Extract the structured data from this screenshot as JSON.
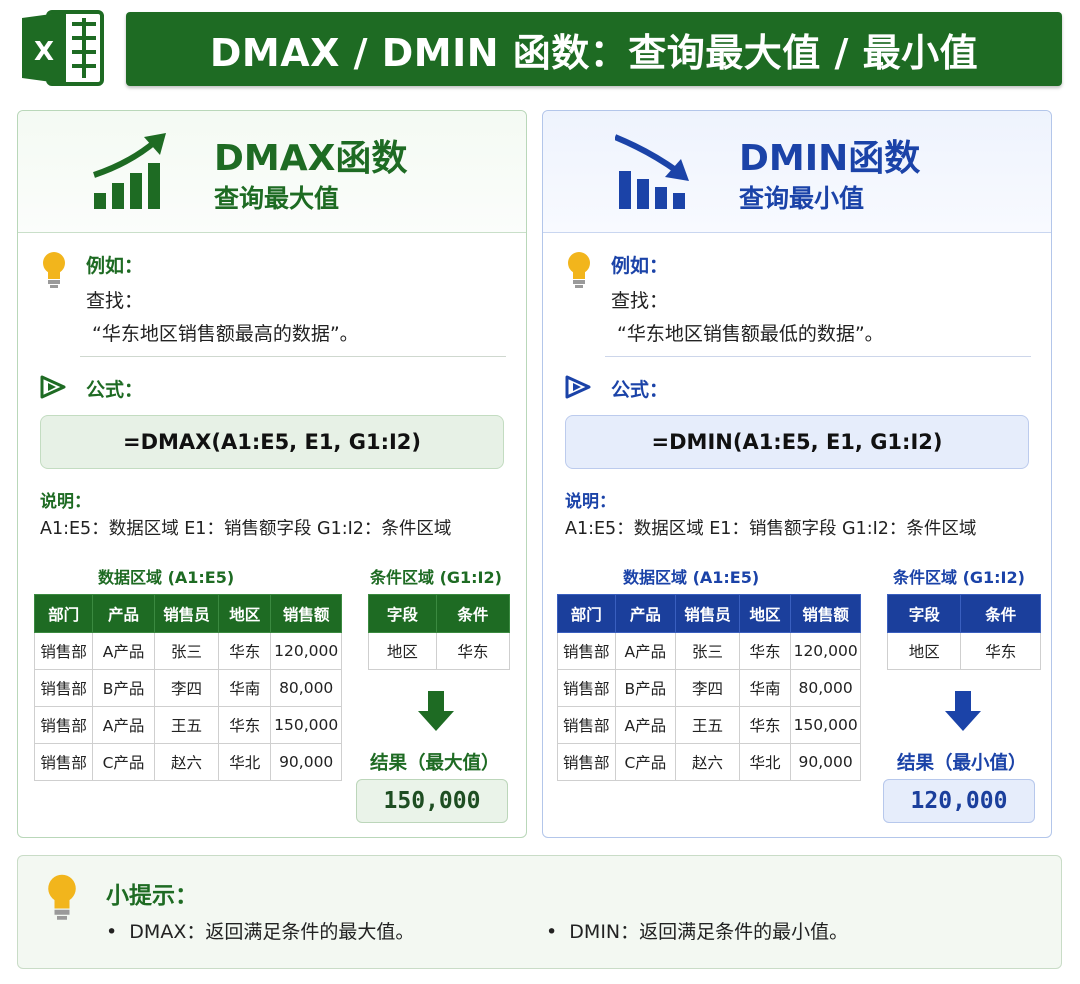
{
  "title": "DMAX / DMIN 函数：查询最大值 / 最小值",
  "logo_letter": "X",
  "colors": {
    "green": "#1e6b23",
    "blue": "#1b3f9c",
    "bulb": "#f2b51c"
  },
  "dmax": {
    "title": "DMAX函数",
    "subtitle": "查询最大值",
    "example_label": "例如：",
    "example_line1": "查找：",
    "example_line2": "“华东地区销售额最高的数据”。",
    "formula_label": "公式：",
    "formula": "=DMAX(A1:E5, E1, G1:I2)",
    "explain_label": "说明：",
    "explain_text": "A1:E5：数据区域    E1：销售额字段    G1:I2：条件区域",
    "data_caption": "数据区域 (A1:E5)",
    "criteria_caption": "条件区域 (G1:I2)",
    "result_label": "结果（最大值）",
    "result_value": "150,000"
  },
  "dmin": {
    "title": "DMIN函数",
    "subtitle": "查询最小值",
    "example_label": "例如：",
    "example_line1": "查找：",
    "example_line2": "“华东地区销售额最低的数据”。",
    "formula_label": "公式：",
    "formula": "=DMIN(A1:E5, E1, G1:I2)",
    "explain_label": "说明：",
    "explain_text": "A1:E5：数据区域    E1：销售额字段    G1:I2：条件区域",
    "data_caption": "数据区域 (A1:E5)",
    "criteria_caption": "条件区域 (G1:I2)",
    "result_label": "结果（最小值）",
    "result_value": "120,000"
  },
  "data_table": {
    "headers": [
      "部门",
      "产品",
      "销售员",
      "地区",
      "销售额"
    ],
    "rows": [
      [
        "销售部",
        "A产品",
        "张三",
        "华东",
        "120,000"
      ],
      [
        "销售部",
        "B产品",
        "李四",
        "华南",
        "80,000"
      ],
      [
        "销售部",
        "A产品",
        "王五",
        "华东",
        "150,000"
      ],
      [
        "销售部",
        "C产品",
        "赵六",
        "华北",
        "90,000"
      ]
    ]
  },
  "criteria_table": {
    "headers": [
      "字段",
      "条件"
    ],
    "rows": [
      [
        "地区",
        "华东"
      ]
    ]
  },
  "tip": {
    "title": "小提示：",
    "items": [
      "DMAX：返回满足条件的最大值。",
      "DMIN：返回满足条件的最小值。"
    ]
  },
  "icons": [
    "excel-logo-icon",
    "growth-chart-icon",
    "decline-chart-icon",
    "lightbulb-icon",
    "play-icon",
    "down-arrow-icon"
  ]
}
